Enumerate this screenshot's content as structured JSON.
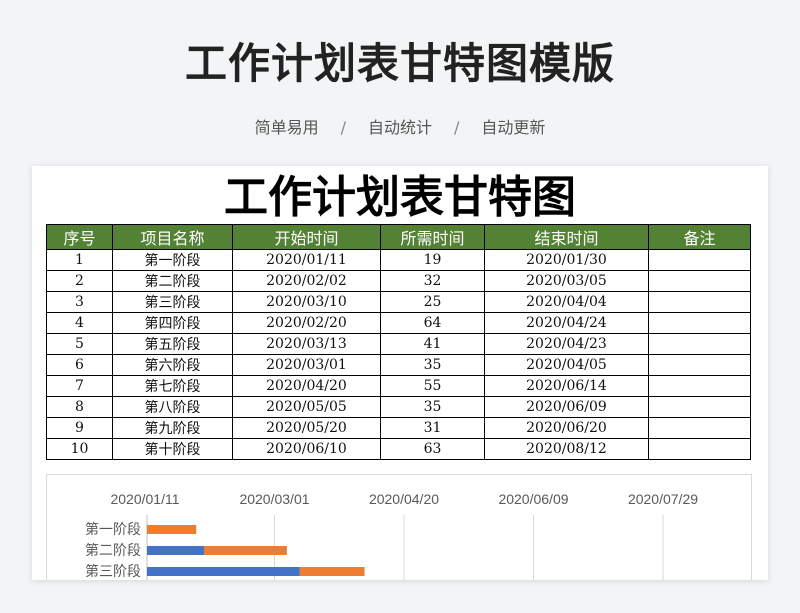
{
  "header": {
    "title": "工作计划表甘特图模版",
    "tags": [
      "简单易用",
      "自动统计",
      "自动更新"
    ],
    "separator": "/"
  },
  "sheet": {
    "title": "工作计划表甘特图",
    "header_color": "#548235",
    "columns": [
      "序号",
      "项目名称",
      "开始时间",
      "所需时间",
      "结束时间",
      "备注"
    ],
    "rows": [
      [
        "1",
        "第一阶段",
        "2020/01/11",
        "19",
        "2020/01/30",
        ""
      ],
      [
        "2",
        "第二阶段",
        "2020/02/02",
        "32",
        "2020/03/05",
        ""
      ],
      [
        "3",
        "第三阶段",
        "2020/03/10",
        "25",
        "2020/04/04",
        ""
      ],
      [
        "4",
        "第四阶段",
        "2020/02/20",
        "64",
        "2020/04/24",
        ""
      ],
      [
        "5",
        "第五阶段",
        "2020/03/13",
        "41",
        "2020/04/23",
        ""
      ],
      [
        "6",
        "第六阶段",
        "2020/03/01",
        "35",
        "2020/04/05",
        ""
      ],
      [
        "7",
        "第七阶段",
        "2020/04/20",
        "55",
        "2020/06/14",
        ""
      ],
      [
        "8",
        "第八阶段",
        "2020/05/05",
        "35",
        "2020/06/09",
        ""
      ],
      [
        "9",
        "第九阶段",
        "2020/05/20",
        "31",
        "2020/06/20",
        ""
      ],
      [
        "10",
        "第十阶段",
        "2020/06/10",
        "63",
        "2020/08/12",
        ""
      ]
    ]
  },
  "chart_data": {
    "type": "bar",
    "orientation": "horizontal-stacked",
    "x_ticks": [
      "2020/01/11",
      "2020/03/01",
      "2020/04/20",
      "2020/06/09",
      "2020/07/29"
    ],
    "categories": [
      "第一阶段",
      "第二阶段",
      "第三阶段"
    ],
    "series": [
      {
        "start_dates": [
          "2020/01/11",
          "2020/02/02",
          "2020/03/10"
        ],
        "color": "#4472c4"
      },
      {
        "durations": [
          19,
          32,
          25
        ],
        "color": "#ed7d31"
      }
    ],
    "grid": true,
    "colors": {
      "start": "#4472c4",
      "duration": "#ed7d31",
      "grid": "#d9d9d9"
    }
  }
}
